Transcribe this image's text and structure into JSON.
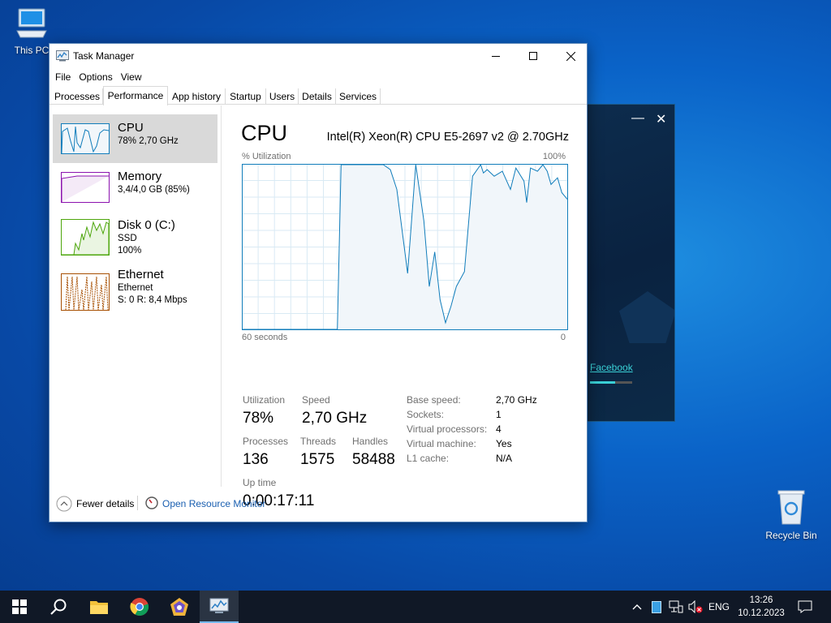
{
  "desktop": {
    "this_pc_label": "This PC",
    "recycle_bin_label": "Recycle Bin"
  },
  "background_window": {
    "link_text": "Facebook",
    "accent_color": "#3ad0d6"
  },
  "task_manager": {
    "title": "Task Manager",
    "menu": [
      "File",
      "Options",
      "View"
    ],
    "tabs": [
      "Processes",
      "Performance",
      "App history",
      "Startup",
      "Users",
      "Details",
      "Services"
    ],
    "active_tab": "Performance",
    "sidebar": [
      {
        "title": "CPU",
        "line1": "78%  2,70 GHz",
        "line2": "",
        "selected": true,
        "color": "#117dbb"
      },
      {
        "title": "Memory",
        "line1": "3,4/4,0 GB (85%)",
        "line2": "",
        "selected": false,
        "color": "#8b12ae"
      },
      {
        "title": "Disk 0 (C:)",
        "line1": "SSD",
        "line2": "100%",
        "selected": false,
        "color": "#4da60c"
      },
      {
        "title": "Ethernet",
        "line1": "Ethernet",
        "line2": "S: 0  R: 8,4 Mbps",
        "selected": false,
        "color": "#a74f01"
      }
    ],
    "cpu": {
      "heading": "CPU",
      "model": "Intel(R) Xeon(R) CPU E5-2697 v2 @ 2.70GHz",
      "utilization_label": "% Utilization",
      "max_label": "100%",
      "x_left": "60 seconds",
      "x_right": "0",
      "stats": {
        "utilization_label": "Utilization",
        "utilization": "78%",
        "speed_label": "Speed",
        "speed": "2,70 GHz",
        "processes_label": "Processes",
        "processes": "136",
        "threads_label": "Threads",
        "threads": "1575",
        "handles_label": "Handles",
        "handles": "58488",
        "uptime_label": "Up time",
        "uptime": "0:00:17:11"
      },
      "specs": [
        {
          "label": "Base speed:",
          "value": "2,70 GHz"
        },
        {
          "label": "Sockets:",
          "value": "1"
        },
        {
          "label": "Virtual processors:",
          "value": "4"
        },
        {
          "label": "Virtual machine:",
          "value": "Yes"
        },
        {
          "label": "L1 cache:",
          "value": "N/A"
        }
      ]
    },
    "footer": {
      "fewer_details": "Fewer details",
      "open_resource_monitor": "Open Resource Monitor"
    }
  },
  "chart_data": {
    "type": "area",
    "title": "CPU",
    "ylabel": "% Utilization",
    "ylim": [
      0,
      100
    ],
    "xlabel_left": "60 seconds",
    "xlabel_right": "0",
    "grid": true,
    "color": "#117dbb",
    "series": [
      {
        "name": "",
        "x": [
          60,
          42.5,
          41.8,
          34.0,
          32.7,
          31.5,
          29.5,
          28.0,
          26.5,
          25.5,
          24.5,
          23.5,
          22.5,
          21.5,
          20.5,
          19.0,
          17.5,
          16.0,
          15.5,
          14.8,
          13.5,
          12.0,
          10.5,
          9.5,
          8.0,
          7.5,
          6.8,
          5.5,
          4.5,
          3.7,
          3.0,
          1.8,
          1.0,
          0
        ],
        "y": [
          0,
          0,
          100,
          100,
          97,
          85,
          34,
          100,
          66,
          26,
          47,
          18,
          4,
          14,
          26,
          35,
          93,
          100,
          95,
          97,
          93,
          96,
          85,
          98,
          90,
          77,
          98,
          96,
          100,
          96,
          88,
          92,
          83,
          79
        ]
      }
    ]
  },
  "taskbar": {
    "apps": [
      "start-icon",
      "search-icon",
      "file-explorer-icon",
      "chrome-icon",
      "app-icon",
      "task-manager-icon"
    ],
    "language": "ENG",
    "time": "13:26",
    "date": "10.12.2023"
  }
}
